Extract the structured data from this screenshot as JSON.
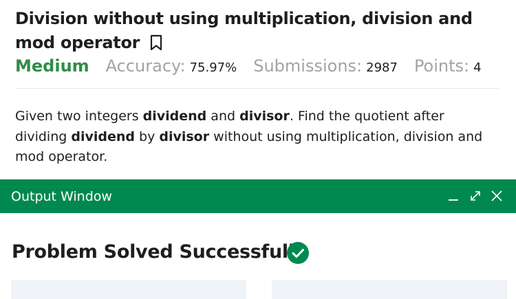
{
  "problem": {
    "title": "Division without using multiplication, division and mod operator",
    "difficulty": "Medium",
    "stats": [
      {
        "label": "Accuracy:",
        "value": "75.97%"
      },
      {
        "label": "Submissions:",
        "value": "2987"
      },
      {
        "label": "Points:",
        "value": "4"
      }
    ],
    "description": [
      {
        "text": "Given two integers ",
        "bold": false
      },
      {
        "text": "dividend",
        "bold": true
      },
      {
        "text": " and ",
        "bold": false
      },
      {
        "text": "divisor",
        "bold": true
      },
      {
        "text": ". Find the quotient after dividing ",
        "bold": false
      },
      {
        "text": "dividend",
        "bold": true
      },
      {
        "text": " by ",
        "bold": false
      },
      {
        "text": "divisor",
        "bold": true
      },
      {
        "text": " without using multiplication, division and mod operator.",
        "bold": false
      }
    ]
  },
  "output_window": {
    "title": "Output Window",
    "controls": [
      "minimize-icon",
      "expand-icon",
      "close-icon"
    ],
    "result_title": "Problem Solved Successfully",
    "result_icon": "check-circle-icon"
  },
  "colors": {
    "brand_green": "#00894f",
    "difficulty_green": "#2f8d46",
    "muted_text": "#a3a3a3",
    "panel_bg": "#f0f4f9"
  }
}
